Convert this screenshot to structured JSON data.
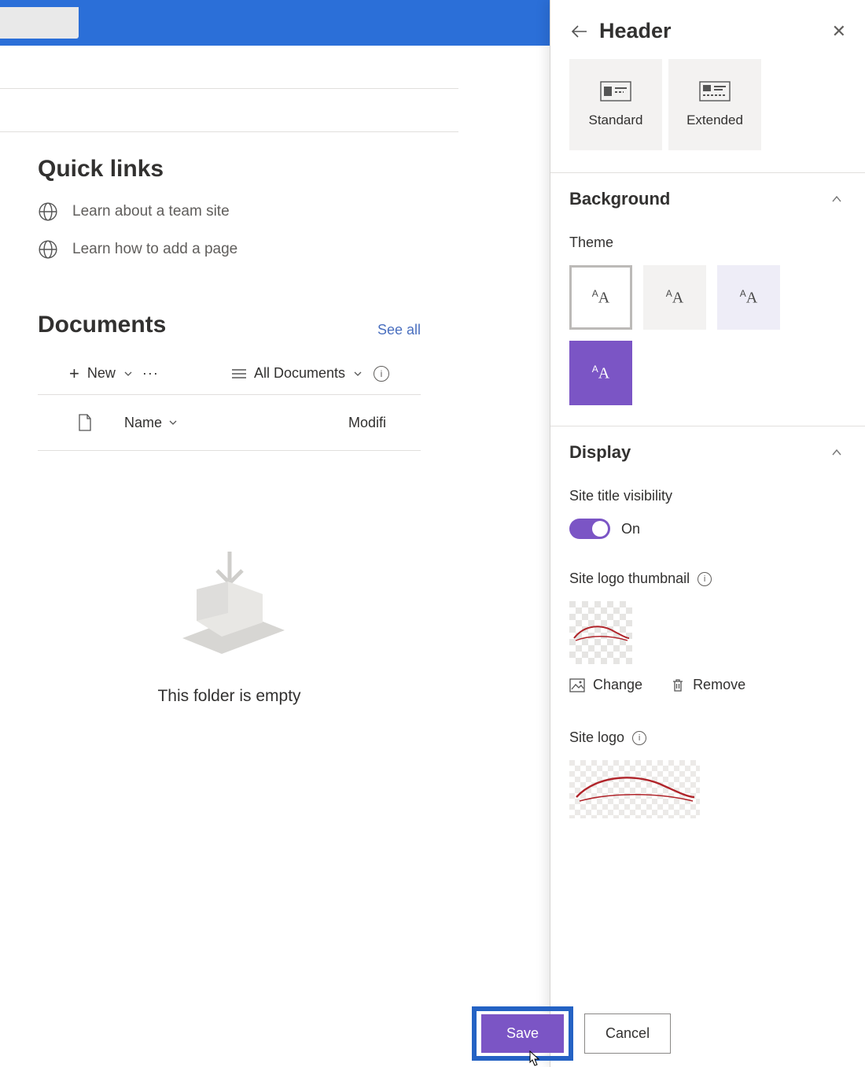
{
  "topbar": {},
  "main": {
    "quicklinks": {
      "heading": "Quick links",
      "items": [
        {
          "label": "Learn about a team site"
        },
        {
          "label": "Learn how to add a page"
        }
      ]
    },
    "documents": {
      "heading": "Documents",
      "see_all": "See all",
      "toolbar": {
        "new_label": "New",
        "view_label": "All Documents"
      },
      "columns": {
        "name": "Name",
        "modified": "Modifi"
      },
      "empty_message": "This folder is empty"
    }
  },
  "pane": {
    "title": "Header",
    "layouts": [
      {
        "label": "Standard"
      },
      {
        "label": "Extended"
      }
    ],
    "background": {
      "heading": "Background",
      "theme_label": "Theme"
    },
    "display": {
      "heading": "Display",
      "site_title_visibility": "Site title visibility",
      "toggle_state": "On",
      "site_logo_thumbnail": "Site logo thumbnail",
      "change": "Change",
      "remove": "Remove",
      "site_logo": "Site logo"
    },
    "footer": {
      "save": "Save",
      "cancel": "Cancel"
    }
  },
  "colors": {
    "purple": "#7b55c5",
    "blue": "#2b6fd8",
    "highlight": "#2462c4"
  }
}
